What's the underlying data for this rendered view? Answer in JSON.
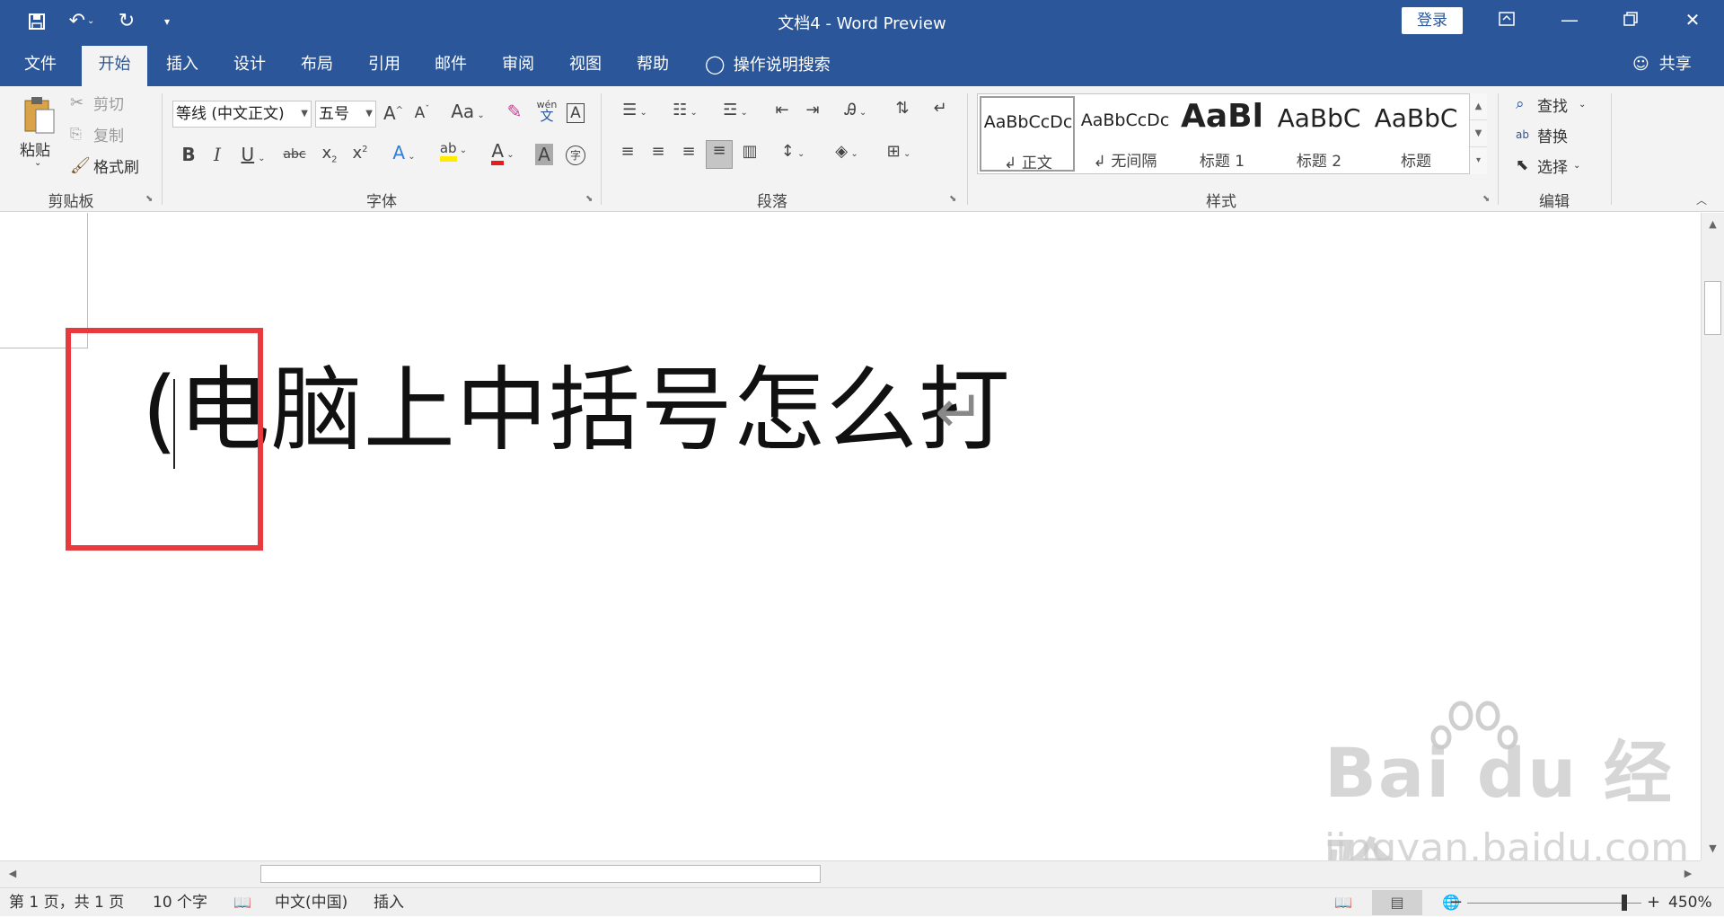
{
  "titlebar": {
    "title": "文档4  -  Word Preview",
    "login_label": "登录",
    "qat_icons": [
      "save-icon",
      "undo-icon",
      "redo-icon",
      "customize-qat-icon"
    ],
    "window_icons": [
      "ribbon-display-options-icon",
      "minimize-icon",
      "restore-icon",
      "close-icon"
    ]
  },
  "tabs": {
    "items": [
      {
        "label": "文件"
      },
      {
        "label": "开始",
        "active": true
      },
      {
        "label": "插入"
      },
      {
        "label": "设计"
      },
      {
        "label": "布局"
      },
      {
        "label": "引用"
      },
      {
        "label": "邮件"
      },
      {
        "label": "审阅"
      },
      {
        "label": "视图"
      },
      {
        "label": "帮助"
      }
    ],
    "tell_me": "操作说明搜索",
    "share": "共享"
  },
  "ribbon": {
    "clipboard": {
      "label": "剪贴板",
      "paste": "粘贴",
      "cut": "剪切",
      "copy": "复制",
      "format_painter": "格式刷"
    },
    "font": {
      "label": "字体",
      "font_name": "等线 (中文正文)",
      "font_size": "五号",
      "change_case": "Aa",
      "phonetic": "wén"
    },
    "paragraph": {
      "label": "段落"
    },
    "styles": {
      "label": "样式",
      "items": [
        {
          "preview": "AaBbCcDc",
          "name": "↲ 正文",
          "selected": true
        },
        {
          "preview": "AaBbCcDc",
          "name": "↲ 无间隔"
        },
        {
          "preview": "AaBl",
          "name": "标题 1"
        },
        {
          "preview": "AaBbC",
          "name": "标题 2"
        },
        {
          "preview": "AaBbC",
          "name": "标题"
        }
      ]
    },
    "editing": {
      "label": "编辑",
      "find": "查找",
      "replace": "替换",
      "select": "选择"
    }
  },
  "document": {
    "paren": "(",
    "body_text": "电脑上中括号怎么打",
    "paragraph_mark": "↵",
    "highlight_color": "#e8393f"
  },
  "watermark": {
    "brand": "Bai du 经验",
    "url": "jingyan.baidu.com"
  },
  "statusbar": {
    "page": "第 1 页，共 1 页",
    "words": "10 个字",
    "language": "中文(中国)",
    "mode": "插入",
    "zoom_label": "450%",
    "zoom_fraction": 0.9
  },
  "colors": {
    "brand": "#2b579a",
    "ribbon_bg": "#f3f3f3"
  }
}
